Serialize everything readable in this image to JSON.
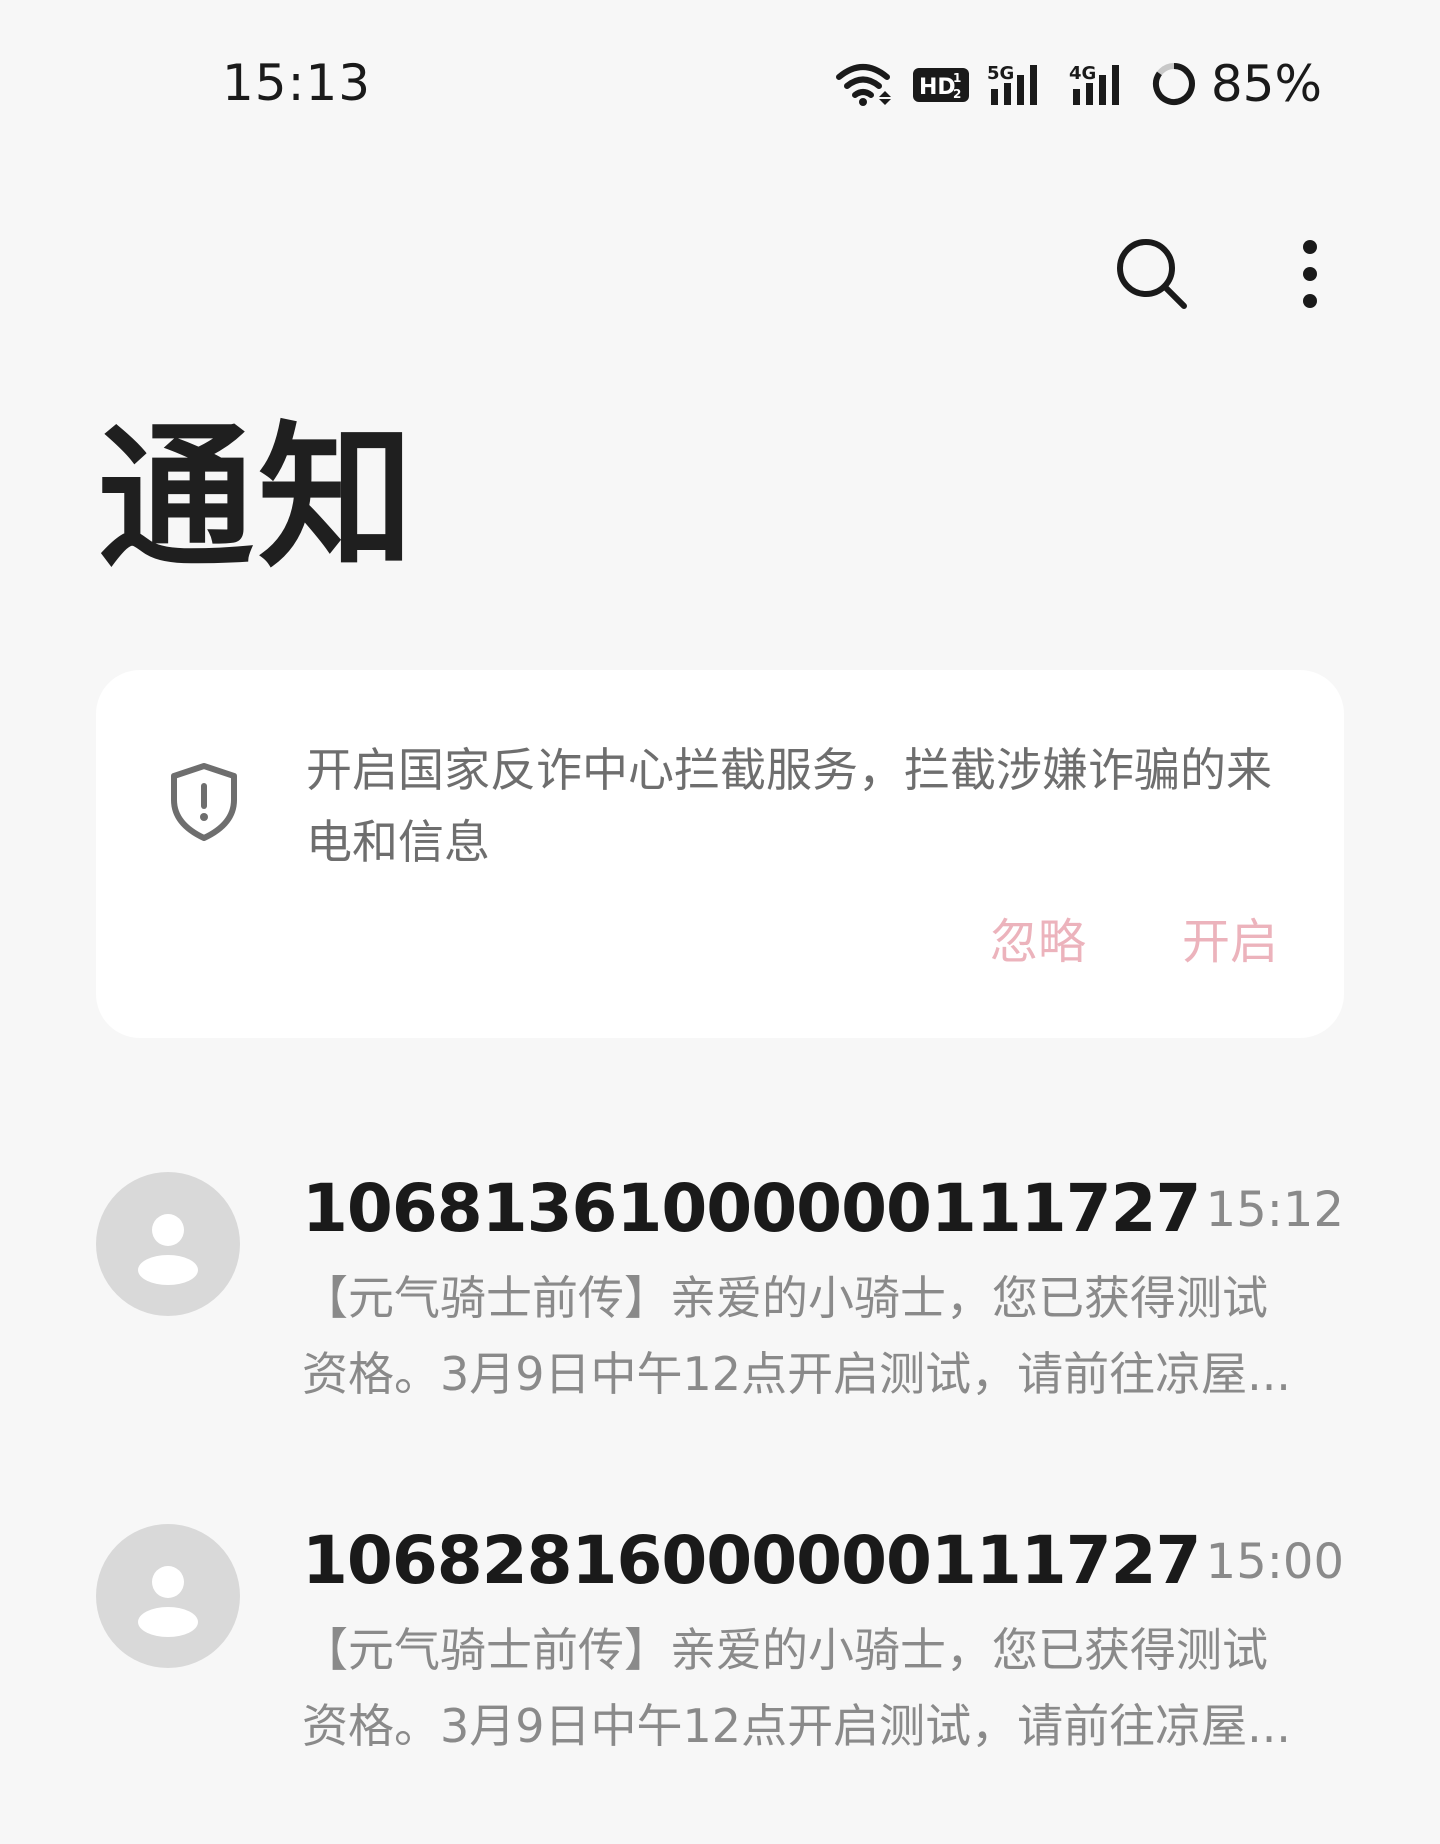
{
  "status_bar": {
    "time": "15:13",
    "battery_percent": "85%",
    "network_5g": "5G",
    "network_4g": "4G",
    "hd_badge": "HD"
  },
  "header": {
    "title": "通知"
  },
  "banner": {
    "text": "开启国家反诈中心拦截服务，拦截涉嫌诈骗的来电和信息",
    "ignore_label": "忽略",
    "enable_label": "开启",
    "accent_color": "#ecb3bc"
  },
  "messages": [
    {
      "sender": "10681361000000111727",
      "time": "15:12",
      "preview": "【元气骑士前传】亲爱的小骑士，您已获得测试资格。3月9日中午12点开启测试，请前往凉屋..."
    },
    {
      "sender": "10682816000000111727",
      "time": "15:00",
      "preview": "【元气骑士前传】亲爱的小骑士，您已获得测试资格。3月9日中午12点开启测试，请前往凉屋..."
    }
  ]
}
